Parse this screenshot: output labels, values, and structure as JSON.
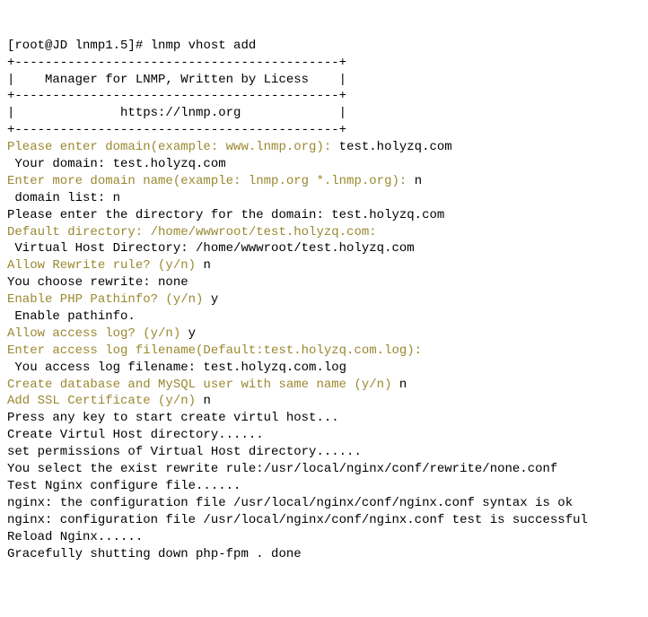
{
  "l1_prompt": "[root@JD lnmp1.5]# ",
  "l1_cmd": "lnmp vhost add",
  "box_top": "+-------------------------------------------+",
  "box_manager": "|    Manager for LNMP, Written by Licess    |",
  "box_mid": "+-------------------------------------------+",
  "box_url": "|              https://lnmp.org             |",
  "box_bot": "+-------------------------------------------+",
  "p_domain_prompt": "Please enter domain(example: www.lnmp.org): ",
  "p_domain_input": "test.holyzq.com",
  "p_domain_echo": " Your domain: test.holyzq.com",
  "p_more_prompt": "Enter more domain name(example: lnmp.org *.lnmp.org): ",
  "p_more_input": "n",
  "p_more_echo": " domain list: n",
  "p_dir_prompt": "Please enter the directory for the domain: test.holyzq.com",
  "p_dir_default": "Default directory: /home/wwwroot/test.holyzq.com:",
  "p_dir_echo": " Virtual Host Directory: /home/wwwroot/test.holyzq.com",
  "p_rewrite_prompt": "Allow Rewrite rule? (y/n) ",
  "p_rewrite_input": "n",
  "p_rewrite_echo": "You choose rewrite: none",
  "p_pathinfo_prompt": "Enable PHP Pathinfo? (y/n) ",
  "p_pathinfo_input": "y",
  "p_pathinfo_echo": " Enable pathinfo.",
  "p_log_prompt": "Allow access log? (y/n) ",
  "p_log_input": "y",
  "p_logname_prompt": "Enter access log filename(Default:test.holyzq.com.log):",
  "p_logname_echo": " You access log filename: test.holyzq.com.log",
  "p_db_prompt": "Create database and MySQL user with same name (y/n) ",
  "p_db_input": "n",
  "p_ssl_prompt": "Add SSL Certificate (y/n) ",
  "p_ssl_input": "n",
  "blank": "",
  "press_key": "Press any key to start create virtul host...",
  "create_dir": "Create Virtul Host directory......",
  "set_perm": "set permissions of Virtual Host directory......",
  "select_rewrite": "You select the exist rewrite rule:/usr/local/nginx/conf/rewrite/none.conf",
  "test_nginx": "Test Nginx configure file......",
  "nginx_syntax": "nginx: the configuration file /usr/local/nginx/conf/nginx.conf syntax is ok",
  "nginx_test": "nginx: configuration file /usr/local/nginx/conf/nginx.conf test is successful",
  "reload_nginx": "Reload Nginx......",
  "gracefully": "Gracefully shutting down php-fpm . done"
}
